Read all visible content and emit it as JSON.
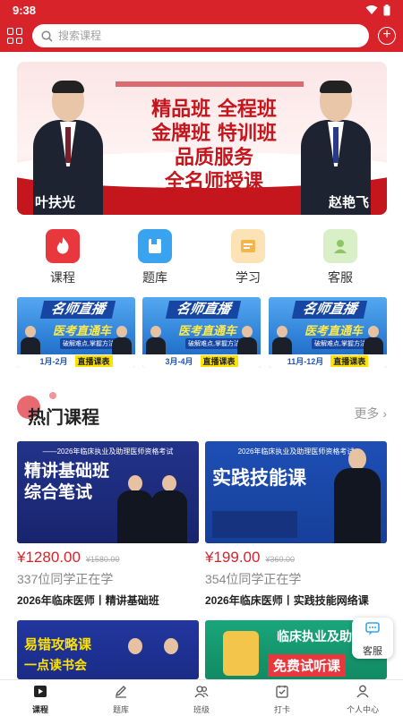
{
  "status_bar": {
    "time": "9:38"
  },
  "header": {
    "search_placeholder": "搜索课程"
  },
  "banner": {
    "lines": [
      "精品班 全程班",
      "金牌班 特训班",
      "品质服务",
      "全名师授课"
    ],
    "left_teacher": "叶扶光",
    "right_teacher": "赵艳飞"
  },
  "quick_nav": [
    {
      "label": "课程",
      "icon": "flame-icon",
      "color": "#e8383d"
    },
    {
      "label": "题库",
      "icon": "book-icon",
      "color": "#3aa3f0"
    },
    {
      "label": "学习",
      "icon": "study-icon",
      "color": "#f3b64a"
    },
    {
      "label": "客服",
      "icon": "service-icon",
      "color": "#8cc665"
    }
  ],
  "live_cards": [
    {
      "title": "名师直播",
      "subtitle": "医考直通车",
      "note": "破解难点,掌握方法",
      "range": "1月-2月",
      "schedule": "直播课表"
    },
    {
      "title": "名师直播",
      "subtitle": "医考直通车",
      "note": "破解难点,掌握方法",
      "range": "3月-4月",
      "schedule": "直播课表"
    },
    {
      "title": "名师直播",
      "subtitle": "医考直通车",
      "note": "破解难点,掌握方法",
      "range": "11月-12月",
      "schedule": "直播课表"
    }
  ],
  "hot": {
    "title": "热门课程",
    "more": "更多"
  },
  "courses": [
    {
      "top_line": "——2026年临床执业及助理医师资格考试",
      "big1": "精讲基础班",
      "big2": "综合笔试",
      "price": "¥1280.00",
      "original": "¥1580.00",
      "learners": "337位同学正在学",
      "name": "2026年临床医师丨精讲基础班"
    },
    {
      "top_line": "2026年临床执业及助理医师资格考试",
      "big1": "实践技能课",
      "big2": "",
      "price": "¥199.00",
      "original": "¥360.00",
      "learners": "354位同学正在学",
      "name": "2026年临床医师丨实践技能网络课"
    }
  ],
  "partial_courses": [
    {
      "big": "易错攻略课",
      "sub": "一点读书会"
    },
    {
      "big": "临床执业及助理",
      "sub": "免费试听课"
    }
  ],
  "float_service": {
    "label": "客服"
  },
  "tabs": [
    {
      "label": "课程",
      "icon": "play-icon",
      "active": true
    },
    {
      "label": "题库",
      "icon": "pencil-icon",
      "active": false
    },
    {
      "label": "班级",
      "icon": "group-icon",
      "active": false
    },
    {
      "label": "打卡",
      "icon": "checkin-icon",
      "active": false
    },
    {
      "label": "个人中心",
      "icon": "person-icon",
      "active": false
    }
  ]
}
